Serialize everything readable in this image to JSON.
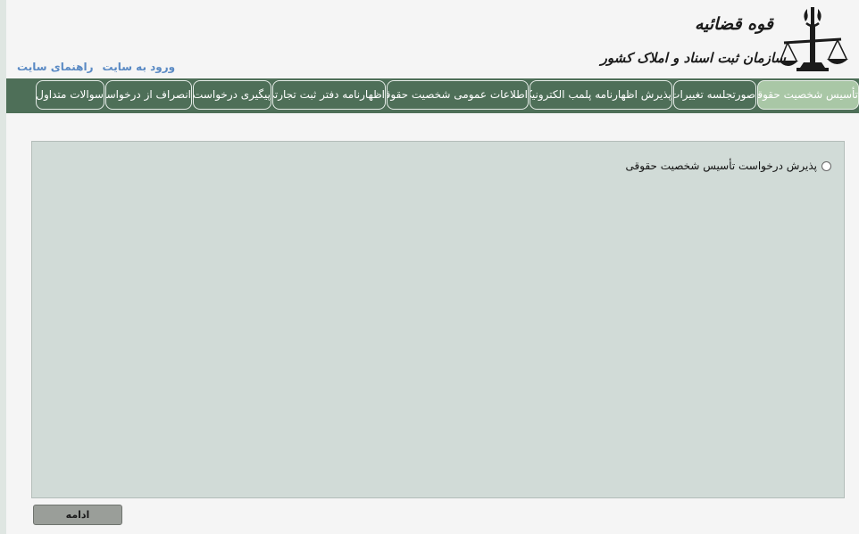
{
  "header": {
    "links": {
      "login": "ورود به سایت",
      "guide": "راهنمای سایت"
    },
    "logo": {
      "line1": "قوه قضائیه",
      "line2": "سازمان ثبت اسناد و املاک کشور"
    }
  },
  "nav": {
    "tabs": [
      {
        "label": "تأسیس شخصیت حقوقی",
        "active": true
      },
      {
        "label": "صورتجلسه تغییرات",
        "active": false
      },
      {
        "label": "پذیرش اظهارنامه پلمب الکترونیک",
        "active": false
      },
      {
        "label": "اطلاعات عمومی شخصیت حقوقی",
        "active": false
      },
      {
        "label": "اظهارنامه دفتر ثبت تجارتی",
        "active": false
      },
      {
        "label": "پیگیری درخواست",
        "active": false
      },
      {
        "label": "انصراف از درخواست",
        "active": false
      },
      {
        "label": "سوالات متداول",
        "active": false
      }
    ]
  },
  "main": {
    "option_label": "پذیرش درخواست تأسیس شخصیت حقوقی",
    "option_selected": false,
    "continue_label": "ادامه"
  },
  "colors": {
    "nav_bg": "#4e6f58",
    "active_tab": "#a9c7a6",
    "panel_bg": "#d1dbd7",
    "link": "#5a8ac4"
  }
}
